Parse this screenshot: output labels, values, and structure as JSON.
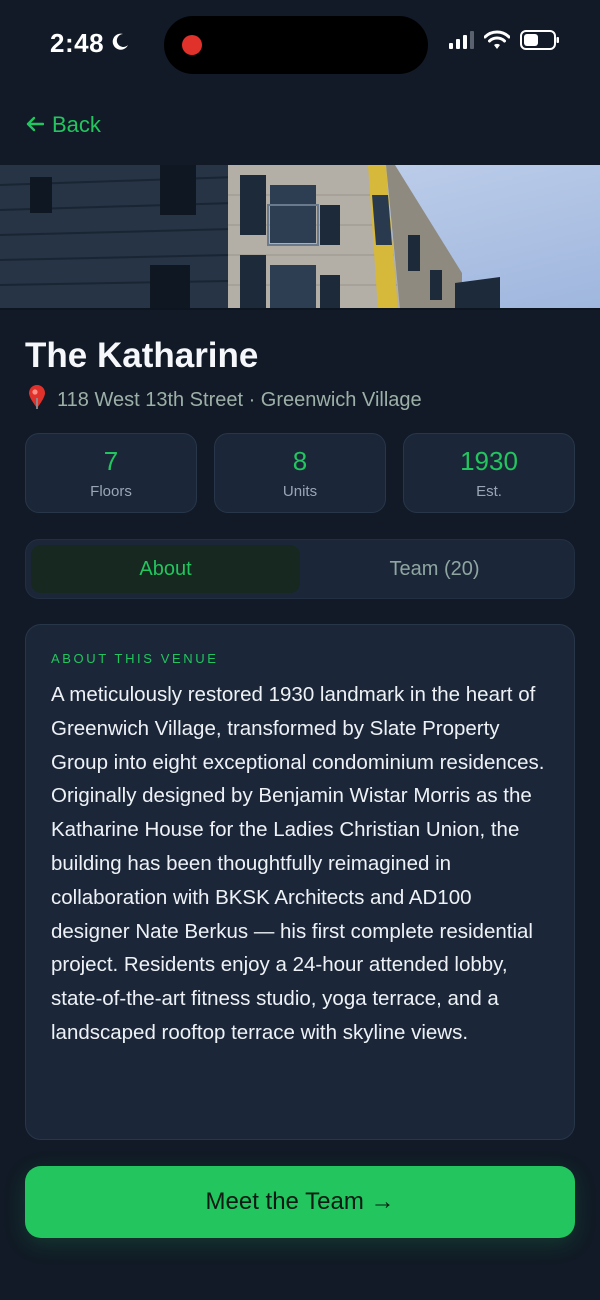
{
  "status_bar": {
    "time": "2:48",
    "icons": [
      "moon-icon",
      "recording-indicator",
      "signal-icon",
      "wifi-icon",
      "battery-icon"
    ]
  },
  "nav": {
    "back_label": "Back"
  },
  "venue": {
    "name": "The Katharine",
    "address": "118 West 13th Street · Greenwich Village"
  },
  "stats": [
    {
      "value": "7",
      "label": "Floors"
    },
    {
      "value": "8",
      "label": "Units"
    },
    {
      "value": "1930",
      "label": "Est."
    }
  ],
  "tabs": [
    {
      "label": "About",
      "active": true
    },
    {
      "label": "Team (20)",
      "active": false
    }
  ],
  "about": {
    "heading": "ABOUT THIS VENUE",
    "body": "A meticulously restored 1930 landmark in the heart of Greenwich Village, transformed by Slate Property Group into eight exceptional condominium residences. Originally designed by Benjamin Wistar Morris as the Katharine House for the Ladies Christian Union, the building has been thoughtfully reimagined in collaboration with BKSK Architects and AD100 designer Nate Berkus — his first complete residential project. Residents enjoy a 24-hour attended lobby, state-of-the-art fitness studio, yoga terrace, and a landscaped rooftop terrace with skyline views."
  },
  "cta": {
    "label": "Meet the Team →"
  },
  "colors": {
    "background": "#111a26",
    "card": "#1b2739",
    "accent": "#22c55e",
    "muted_text": "#9db0a8"
  }
}
